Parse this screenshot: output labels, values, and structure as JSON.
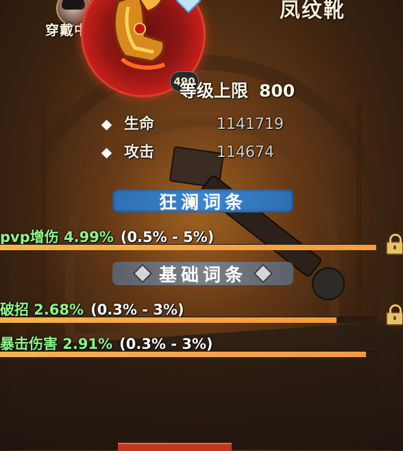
{
  "equipped_label": "穿戴中",
  "item": {
    "name": "凤纹靴",
    "level_badge": "490",
    "level_cap_label": "等级上限",
    "level_cap_value": "800",
    "frame_color": "#c51f1a"
  },
  "stats": [
    {
      "label": "生命",
      "value": "1141719"
    },
    {
      "label": "攻击",
      "value": "114674"
    }
  ],
  "sections": {
    "rampage_title": "狂澜词条",
    "basic_title": "基础词条"
  },
  "attributes": [
    {
      "name": "pvp增伤 4.99%",
      "range": "(0.5% - 5%)",
      "fill": 0.998,
      "locked": true
    },
    {
      "name": "破招 2.68%",
      "range": "(0.3% - 3%)",
      "fill": 0.893,
      "locked": true
    },
    {
      "name": "暴击伤害 2.91%",
      "range": "(0.3% - 3%)",
      "fill": 0.97,
      "locked": false
    }
  ],
  "colors": {
    "attribute_name": "#8ef58a",
    "bar_fill": "#f59a3d",
    "rampage_banner": "#3c86cc",
    "basic_banner": "#7b8089"
  }
}
